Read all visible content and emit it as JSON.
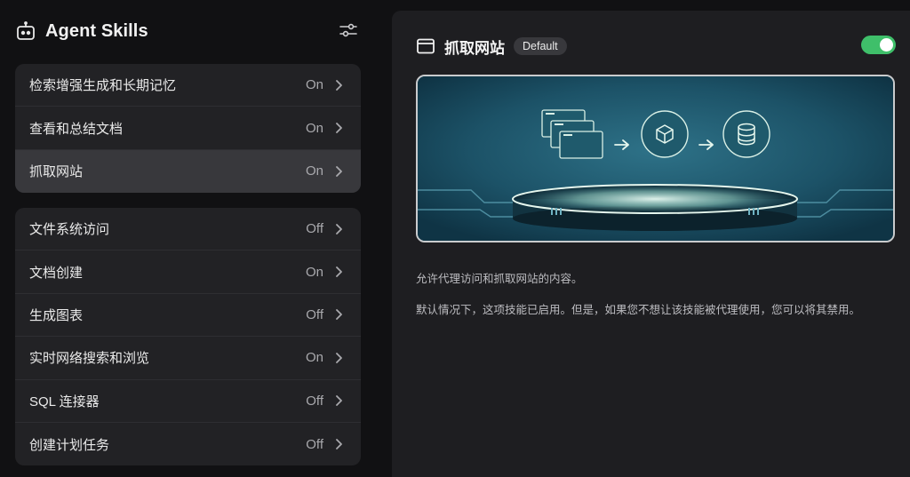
{
  "sidebar": {
    "title": "Agent Skills",
    "group1": [
      {
        "label": "检索增强生成和长期记忆",
        "status": "On"
      },
      {
        "label": "查看和总结文档",
        "status": "On"
      },
      {
        "label": "抓取网站",
        "status": "On",
        "active": true
      }
    ],
    "group2": [
      {
        "label": "文件系统访问",
        "status": "Off"
      },
      {
        "label": "文档创建",
        "status": "On"
      },
      {
        "label": "生成图表",
        "status": "Off"
      },
      {
        "label": "实时网络搜索和浏览",
        "status": "On"
      },
      {
        "label": "SQL 连接器",
        "status": "Off"
      },
      {
        "label": "创建计划任务",
        "status": "Off"
      }
    ]
  },
  "panel": {
    "title": "抓取网站",
    "badge": "Default",
    "toggle_on": true,
    "description": "允许代理访问和抓取网站的内容。",
    "note": "默认情况下，这项技能已启用。但是，如果您不想让该技能被代理使用，您可以将其禁用。"
  },
  "colors": {
    "accent_green": "#3fbf6a",
    "panel_bg": "#1e1e21",
    "group_bg": "#222225",
    "active_row_bg": "#38383c"
  },
  "icons": {
    "header": "robot-icon",
    "settings": "sliders-icon",
    "row": "chevron-right-icon",
    "panel": "browser-window-icon"
  }
}
